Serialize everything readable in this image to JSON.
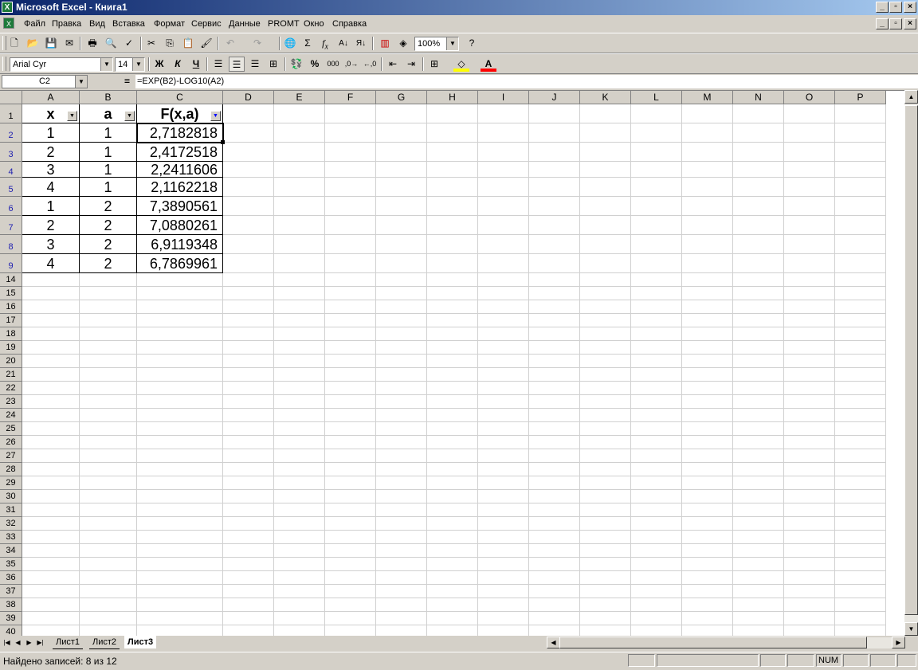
{
  "window": {
    "title": "Microsoft Excel - Книга1",
    "min": "_",
    "restore": "▫",
    "close": "×"
  },
  "menu": [
    "Файл",
    "Правка",
    "Вид",
    "Вставка",
    "Формат",
    "Сервис",
    "Данные",
    "PROMT",
    "Окно",
    "Справка"
  ],
  "toolbar": {
    "zoom": "100%",
    "font_name": "Arial Cyr",
    "font_size": "14",
    "bold": "Ж",
    "italic": "К",
    "underline": "Ч",
    "percent": "%",
    "thousands": "000",
    "sum": "Σ",
    "fx": "f",
    "fx_sub": "x"
  },
  "formula_bar": {
    "cell_ref": "C2",
    "equals": "=",
    "formula": "=EXP(B2)-LOG10(A2)"
  },
  "columns": [
    "A",
    "B",
    "C",
    "D",
    "E",
    "F",
    "G",
    "H",
    "I",
    "J",
    "K",
    "L",
    "M",
    "N",
    "O",
    "P"
  ],
  "rows": [
    "1",
    "2",
    "3",
    "4",
    "5",
    "6",
    "7",
    "8",
    "9",
    "14",
    "15",
    "16",
    "17",
    "18",
    "19",
    "20",
    "21",
    "22",
    "23",
    "24",
    "25",
    "26",
    "27",
    "28",
    "29",
    "30",
    "31",
    "32",
    "33",
    "34",
    "35",
    "36",
    "37",
    "38",
    "39",
    "40"
  ],
  "table": {
    "headers": [
      "x",
      "a",
      "F(x,a)"
    ],
    "data": [
      [
        "1",
        "1",
        "2,7182818"
      ],
      [
        "2",
        "1",
        "2,4172518"
      ],
      [
        "3",
        "1",
        "2,2411606"
      ],
      [
        "4",
        "1",
        "2,1162218"
      ],
      [
        "1",
        "2",
        "7,3890561"
      ],
      [
        "2",
        "2",
        "7,0880261"
      ],
      [
        "3",
        "2",
        "6,9119348"
      ],
      [
        "4",
        "2",
        "6,7869961"
      ]
    ]
  },
  "sheet_tabs": [
    "Лист1",
    "Лист2",
    "Лист3"
  ],
  "active_tab": "Лист3",
  "status": {
    "text": "Найдено записей: 8 из 12",
    "num": "NUM"
  }
}
